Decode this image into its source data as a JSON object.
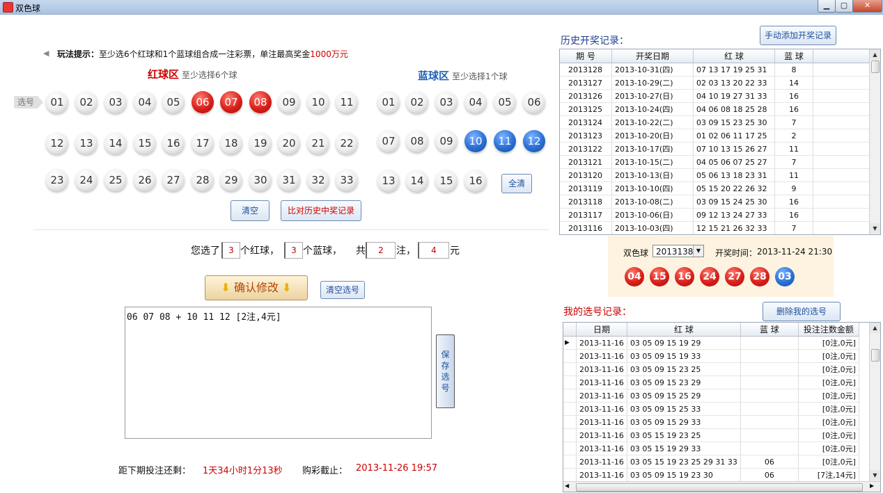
{
  "window": {
    "title": "双色球",
    "min": "▁",
    "max": "▢",
    "close": "✕"
  },
  "tip": {
    "label": "玩法提示：",
    "text_a": "至少选6个红球和1个蓝球组合成一注彩票，单注最高奖金",
    "highlight": "1000万元"
  },
  "red_zone": {
    "title": "红球区",
    "sub": "至少选择6个球",
    "select_tag": "选号",
    "balls": [
      "01",
      "02",
      "03",
      "04",
      "05",
      "06",
      "07",
      "08",
      "09",
      "10",
      "11",
      "12",
      "13",
      "14",
      "15",
      "16",
      "17",
      "18",
      "19",
      "20",
      "21",
      "22",
      "23",
      "24",
      "25",
      "26",
      "27",
      "28",
      "29",
      "30",
      "31",
      "32",
      "33"
    ],
    "selected": [
      "06",
      "07",
      "08"
    ]
  },
  "blue_zone": {
    "title": "蓝球区",
    "sub": "至少选择1个球",
    "balls": [
      "01",
      "02",
      "03",
      "04",
      "05",
      "06",
      "07",
      "08",
      "09",
      "10",
      "11",
      "12",
      "13",
      "14",
      "15",
      "16"
    ],
    "selected": [
      "10",
      "11",
      "12"
    ],
    "clear_all": "全清"
  },
  "buttons": {
    "clear": "清空",
    "compare": "比对历史中奖记录",
    "confirm": "确认修改",
    "clear_selection": "清空选号",
    "save": "保存选号"
  },
  "summary": {
    "p1": "您选了",
    "red_count": "3",
    "p2": "个红球，",
    "blue_count": "3",
    "p3": "个蓝球，",
    "p4": "共",
    "bets": "2",
    "p5": "注，",
    "amount": "4",
    "p6": "元"
  },
  "textarea": {
    "value": "06 07 08 + 10 11 12 [2注,4元]"
  },
  "countdown": {
    "label": "距下期投注还剩：",
    "remaining": "1天34小时1分13秒",
    "deadline_label": "购彩截止：",
    "deadline": "2013-11-26 19:57"
  },
  "history": {
    "title": "历史开奖记录：",
    "add_button": "手动添加开奖记录",
    "columns": [
      "期  号",
      "开奖日期",
      "红  球",
      "蓝  球"
    ],
    "rows": [
      [
        "2013128",
        "2013-10-31(四)",
        "07 13 17 19 25 31",
        "8"
      ],
      [
        "2013127",
        "2013-10-29(二)",
        "02 03 13 20 22 33",
        "14"
      ],
      [
        "2013126",
        "2013-10-27(日)",
        "04 10 19 27 31 33",
        "16"
      ],
      [
        "2013125",
        "2013-10-24(四)",
        "04 06 08 18 25 28",
        "16"
      ],
      [
        "2013124",
        "2013-10-22(二)",
        "03 09 15 23 25 30",
        "7"
      ],
      [
        "2013123",
        "2013-10-20(日)",
        "01 02 06 11 17 25",
        "2"
      ],
      [
        "2013122",
        "2013-10-17(四)",
        "07 10 13 15 26 27",
        "11"
      ],
      [
        "2013121",
        "2013-10-15(二)",
        "04 05 06 07 25 27",
        "7"
      ],
      [
        "2013120",
        "2013-10-13(日)",
        "05 06 13 18 23 31",
        "11"
      ],
      [
        "2013119",
        "2013-10-10(四)",
        "05 15 20 22 26 32",
        "9"
      ],
      [
        "2013118",
        "2013-10-08(二)",
        "03 09 15 24 25 30",
        "16"
      ],
      [
        "2013117",
        "2013-10-06(日)",
        "09 12 13 24 27 33",
        "16"
      ],
      [
        "2013116",
        "2013-10-03(四)",
        "12 15 21 26 32 33",
        "7"
      ]
    ]
  },
  "draw": {
    "label": "双色球",
    "issue": "2013138",
    "time_label": "开奖时间：",
    "time": "2013-11-24 21:30",
    "red": [
      "04",
      "15",
      "16",
      "24",
      "27",
      "28"
    ],
    "blue": "03"
  },
  "mine": {
    "title": "我的选号记录：",
    "delete_button": "删除我的选号",
    "columns": [
      "日期",
      "红  球",
      "蓝  球",
      "投注注数金额"
    ],
    "rows": [
      [
        "2013-11-16",
        "03 05 09 15 19 29",
        "",
        "[0注,0元]"
      ],
      [
        "2013-11-16",
        "03 05 09 15 19 33",
        "",
        "[0注,0元]"
      ],
      [
        "2013-11-16",
        "03 05 09 15 23 25",
        "",
        "[0注,0元]"
      ],
      [
        "2013-11-16",
        "03 05 09 15 23 29",
        "",
        "[0注,0元]"
      ],
      [
        "2013-11-16",
        "03 05 09 15 25 29",
        "",
        "[0注,0元]"
      ],
      [
        "2013-11-16",
        "03 05 09 15 25 33",
        "",
        "[0注,0元]"
      ],
      [
        "2013-11-16",
        "03 05 09 15 29 33",
        "",
        "[0注,0元]"
      ],
      [
        "2013-11-16",
        "03 05 15 19 23 25",
        "",
        "[0注,0元]"
      ],
      [
        "2013-11-16",
        "03 05 15 19 29 33",
        "",
        "[0注,0元]"
      ],
      [
        "2013-11-16",
        "03 05 15 19 23 25 29 31 33",
        "06",
        "[0注,0元]"
      ],
      [
        "2013-11-16",
        "03 05 09 15 19 23 30",
        "06",
        "[7注,14元]"
      ]
    ]
  }
}
